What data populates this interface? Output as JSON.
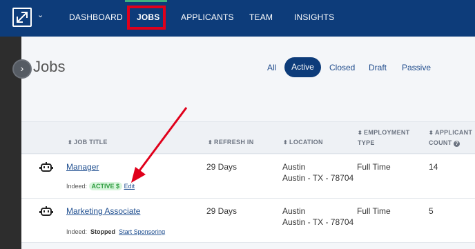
{
  "nav": {
    "items": [
      {
        "label": "DASHBOARD"
      },
      {
        "label": "JOBS"
      },
      {
        "label": "APPLICANTS"
      },
      {
        "label": "TEAM"
      },
      {
        "label": "INSIGHTS"
      }
    ],
    "caret": "⌄",
    "toggle": "›"
  },
  "page": {
    "title": "Jobs",
    "filters": [
      "All",
      "Active",
      "Closed",
      "Draft",
      "Passive"
    ],
    "active_filter": "Active"
  },
  "table": {
    "columns": [
      {
        "label": "JOB TITLE"
      },
      {
        "label": "REFRESH IN"
      },
      {
        "label": "LOCATION"
      },
      {
        "label_line1": "EMPLOYMENT",
        "label_line2": "TYPE"
      },
      {
        "label_line1": "APPLICANT",
        "label_line2": "COUNT"
      }
    ],
    "rows": [
      {
        "title": "Manager",
        "refresh": "29 Days",
        "location_line1": "Austin",
        "location_line2": "Austin - TX - 78704",
        "employment": "Full Time",
        "count": "14",
        "source": "Indeed:",
        "status": "ACTIVE $",
        "action": "Edit"
      },
      {
        "title": "Marketing Associate",
        "refresh": "29 Days",
        "location_line1": "Austin",
        "location_line2": "Austin - TX - 78704",
        "employment": "Full Time",
        "count": "5",
        "source": "Indeed:",
        "status": "Stopped",
        "action": "Start Sponsoring"
      }
    ]
  },
  "colors": {
    "nav_bg": "#0d3c7a",
    "accent_green": "#3fb27f",
    "highlight_red": "#e0001b",
    "link": "#1d4d8f"
  }
}
